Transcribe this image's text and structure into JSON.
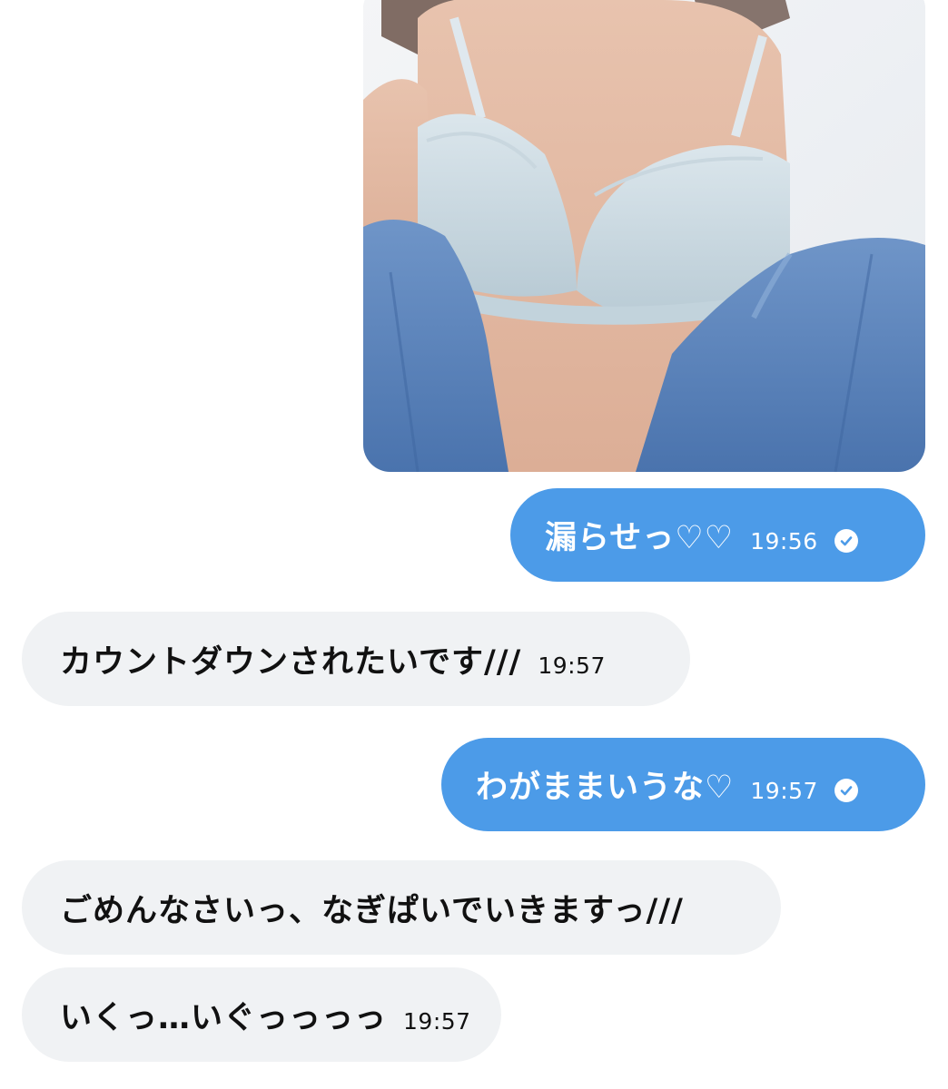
{
  "conversation": {
    "messages": [
      {
        "direction": "sent",
        "type": "image",
        "image": "photo-attachment"
      },
      {
        "direction": "sent",
        "text": "漏らせっ♡♡",
        "time": "19:56",
        "status_icon": "read-check-icon"
      },
      {
        "direction": "received",
        "text": "カウントダウンされたいです///",
        "time": "19:57"
      },
      {
        "direction": "sent",
        "text": "わがままいうな♡",
        "time": "19:57",
        "status_icon": "read-check-icon"
      },
      {
        "direction": "received",
        "text": "ごめんなさいっ、なぎぱいでいきますっ///"
      },
      {
        "direction": "received",
        "text": "いくっ…いぐっっっっ",
        "time": "19:57"
      }
    ]
  },
  "colors": {
    "sent_bubble": "#4c9be8",
    "received_bubble": "#f0f2f4",
    "background": "#ffffff"
  }
}
